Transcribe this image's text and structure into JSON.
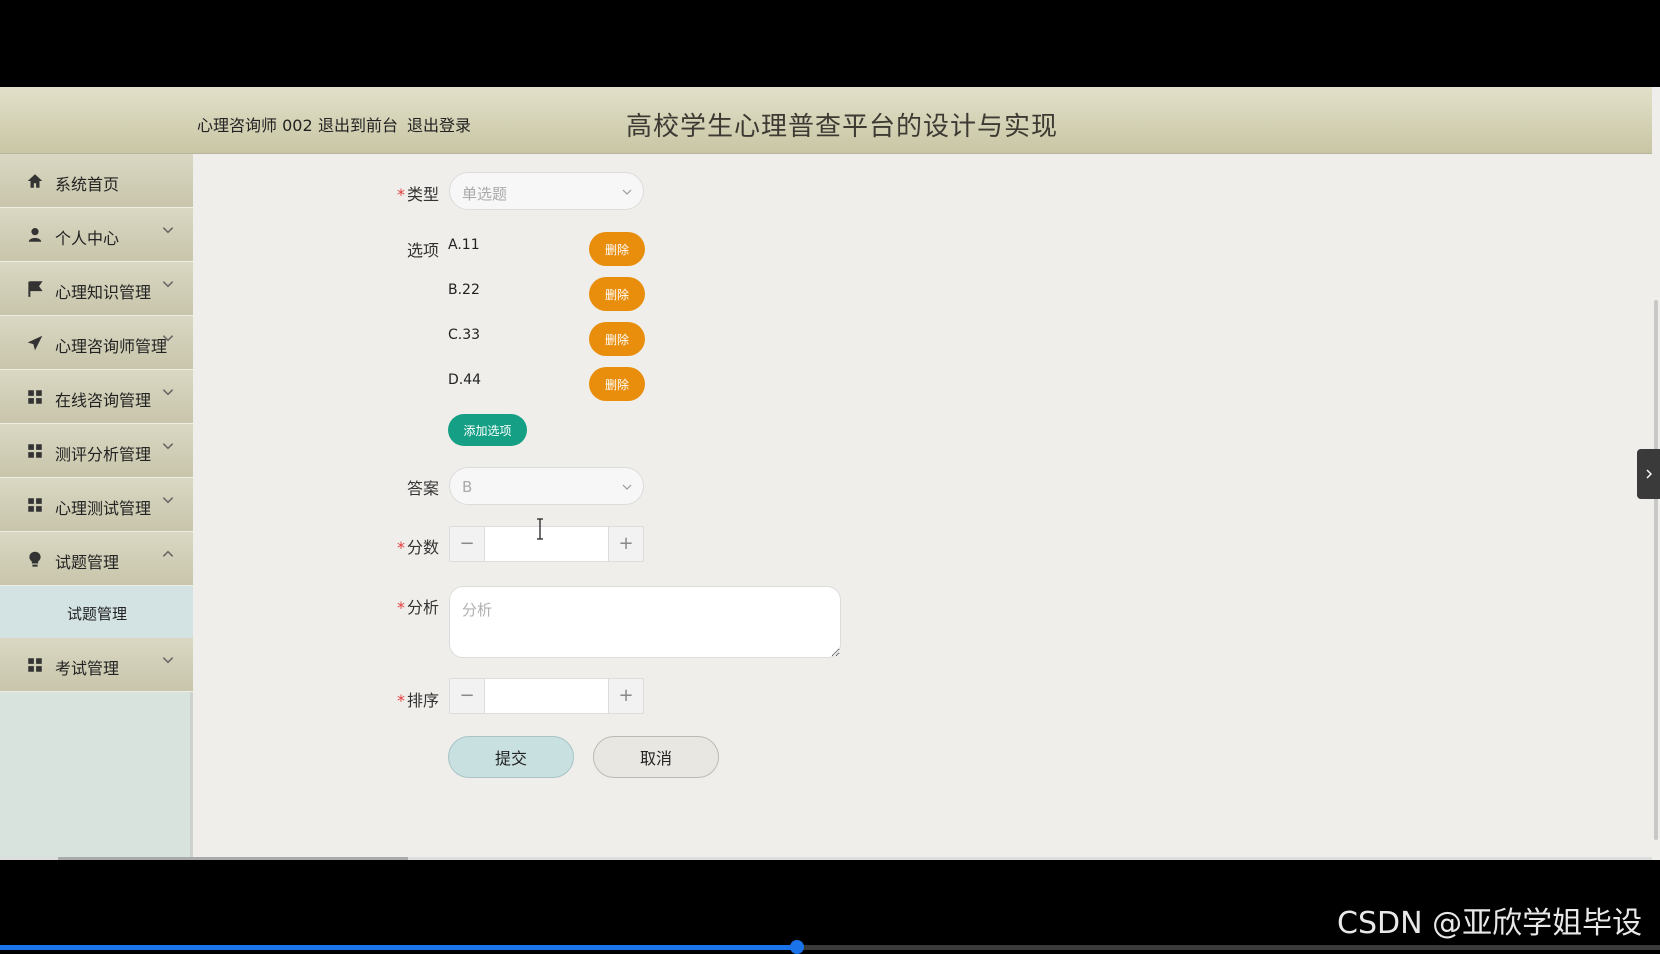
{
  "header": {
    "user": "心理咨询师 002",
    "to_front": "退出到前台",
    "logout": "退出登录",
    "site_title": "高校学生心理普查平台的设计与实现"
  },
  "sidebar": {
    "items": [
      {
        "label": "系统首页",
        "icon": "home-icon"
      },
      {
        "label": "个人中心",
        "icon": "user-icon"
      },
      {
        "label": "心理知识管理",
        "icon": "flag-icon"
      },
      {
        "label": "心理咨询师管理",
        "icon": "send-icon"
      },
      {
        "label": "在线咨询管理",
        "icon": "grid-icon"
      },
      {
        "label": "测评分析管理",
        "icon": "grid-icon"
      },
      {
        "label": "心理测试管理",
        "icon": "grid-icon"
      },
      {
        "label": "试题管理",
        "icon": "bulb-icon"
      },
      {
        "label": "考试管理",
        "icon": "grid-icon"
      }
    ],
    "sub_item": "试题管理"
  },
  "form": {
    "type_label": "类型",
    "type_value": "单选题",
    "options_label": "选项",
    "options": [
      "A.11",
      "B.22",
      "C.33",
      "D.44"
    ],
    "delete_label": "删除",
    "add_option_label": "添加选项",
    "answer_label": "答案",
    "answer_value": "B",
    "score_label": "分数",
    "score_value": "",
    "analysis_label": "分析",
    "analysis_placeholder": "分析",
    "sort_label": "排序",
    "sort_value": "",
    "submit_label": "提交",
    "cancel_label": "取消"
  },
  "video": {
    "progress": 0.48
  },
  "watermark": "CSDN @亚欣学姐毕设",
  "colors": {
    "delete_button": "#e98e0c",
    "add_button": "#15a086",
    "required_mark": "#e23d3d"
  }
}
